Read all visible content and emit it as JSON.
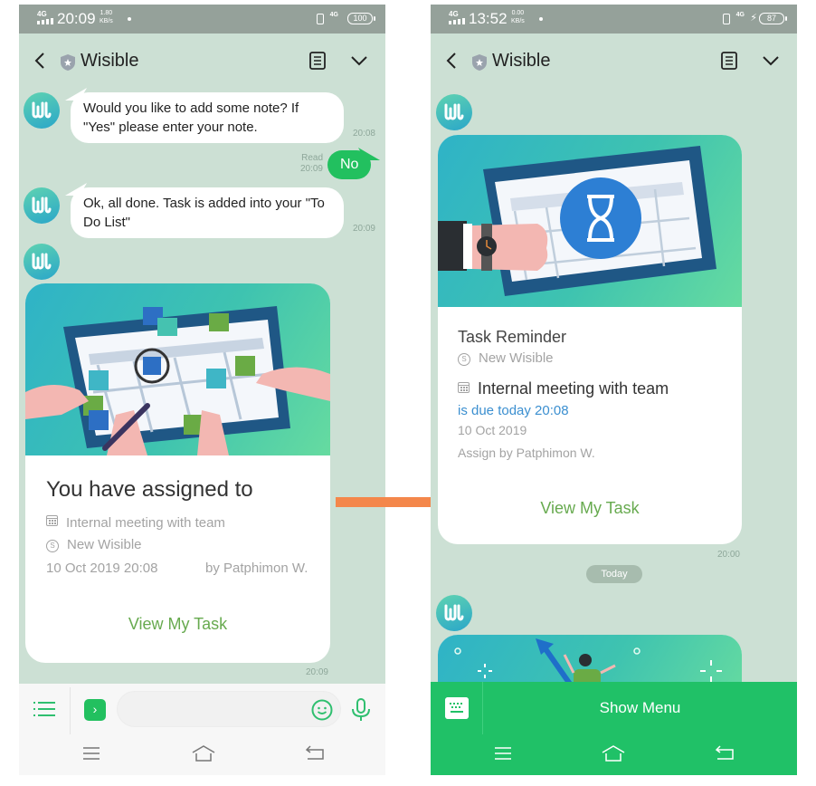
{
  "arrow": {
    "color": "#f4874b",
    "direction": "left-to-right"
  },
  "left_screen": {
    "status_bar": {
      "network": "4G",
      "time": "20:09",
      "speed_value": "1.80",
      "speed_unit": "KB/s",
      "data_network": "4G",
      "battery": "100"
    },
    "header": {
      "title": "Wisible",
      "icons": [
        "back-icon",
        "shield-star-icon",
        "notes-icon",
        "chevron-down-icon"
      ]
    },
    "messages": [
      {
        "from": "bot",
        "text": "Would you like to add some note?  If \"Yes\" please enter your note.",
        "time": "20:08"
      },
      {
        "from": "me",
        "text": "No",
        "status": "Read",
        "time": "20:09"
      },
      {
        "from": "bot",
        "text": "Ok, all done. Task is added into your \"To Do List\"",
        "time": "20:09"
      }
    ],
    "card": {
      "title": "You have assigned to",
      "task": "Internal meeting with team",
      "project": "New Wisible",
      "datetime": "10 Oct 2019 20:08",
      "assigned_by": "by Patphimon W.",
      "cta": "View My Task",
      "time": "20:09"
    },
    "composer": {
      "placeholder": "",
      "value": "",
      "icons": [
        "list-menu-icon",
        "extension-icon",
        "emoji-icon",
        "microphone-icon"
      ]
    },
    "nav": [
      "recent-apps-icon",
      "home-icon",
      "back-icon"
    ]
  },
  "right_screen": {
    "status_bar": {
      "network": "4G",
      "time": "13:52",
      "speed_value": "0.00",
      "speed_unit": "KB/s",
      "data_network": "4G",
      "battery": "87",
      "charging": true
    },
    "header": {
      "title": "Wisible"
    },
    "card": {
      "title": "Task Reminder",
      "project": "New Wisible",
      "task": "Internal meeting with team",
      "due": "is due today 20:08",
      "date": "10 Oct 2019",
      "assigned_by": "Assign by Patphimon W.",
      "cta": "View My Task",
      "time": "20:00"
    },
    "day_separator": "Today",
    "menu_bar": {
      "label": "Show Menu"
    },
    "colors": {
      "accent": "#20c167",
      "due_text": "#3b8fd0",
      "cta_text": "#67aa4f"
    }
  }
}
